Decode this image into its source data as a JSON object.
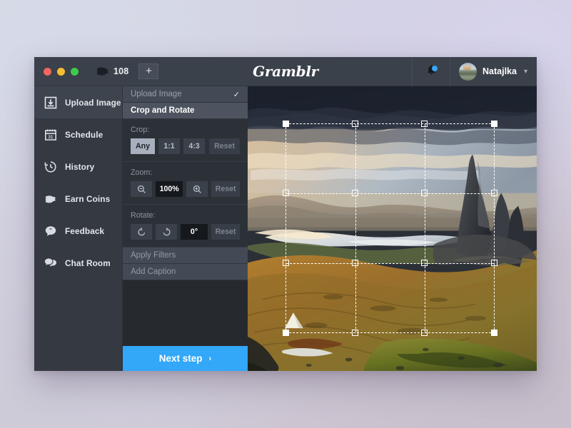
{
  "app": {
    "name": "Gramblr",
    "logo_text": "Gramblr"
  },
  "titlebar": {
    "coin_icon": "coins-stack-icon",
    "coin_count": "108",
    "add_label": "+",
    "bell_icon": "bell-icon",
    "notification_dot_color": "#37a6f5",
    "avatar_icon": "user-avatar",
    "username": "Natajlka",
    "chevron": "⌄"
  },
  "window_controls": {
    "close_color": "#f1675f",
    "minimize_color": "#f5bf32",
    "maximize_color": "#3ecb49"
  },
  "sidebar": {
    "items": [
      {
        "label": "Upload Image",
        "icon": "upload-box-icon",
        "active": true
      },
      {
        "label": "Schedule",
        "icon": "calendar-icon",
        "active": false
      },
      {
        "label": "History",
        "icon": "clock-history-icon",
        "active": false
      },
      {
        "label": "Earn Coins",
        "icon": "coins-stack-icon",
        "active": false
      },
      {
        "label": "Feedback",
        "icon": "quote-bubble-icon",
        "active": false
      },
      {
        "label": "Chat Room",
        "icon": "chat-bubbles-icon",
        "active": false
      }
    ]
  },
  "panel": {
    "steps": [
      {
        "label": "Upload Image",
        "state": "done",
        "check": "✓"
      },
      {
        "label": "Crop and Rotate",
        "state": "current"
      }
    ],
    "crop": {
      "label": "Crop:",
      "options": [
        {
          "label": "Any",
          "selected": true
        },
        {
          "label": "1:1",
          "selected": false
        },
        {
          "label": "4:3",
          "selected": false
        }
      ],
      "reset_label": "Reset"
    },
    "zoom": {
      "label": "Zoom:",
      "zoom_out_icon": "magnifier-minus-icon",
      "value": "100%",
      "zoom_in_icon": "magnifier-plus-icon",
      "reset_label": "Reset"
    },
    "rotate": {
      "label": "Rotate:",
      "rotate_ccw_icon": "rotate-left-icon",
      "rotate_cw_icon": "rotate-right-icon",
      "value": "0°",
      "reset_label": "Reset"
    },
    "later_steps": [
      {
        "label": "Apply Filters"
      },
      {
        "label": "Add Caption"
      }
    ],
    "next_label": "Next step",
    "next_arrow": "›",
    "accent_color": "#33a7f8"
  },
  "canvas": {
    "image_description": "Mountain landscape at sunrise with rocky pinnacle, loch and golden hillside",
    "crop_overlay": {
      "guides": "rule-of-thirds",
      "handle_count": 8
    }
  }
}
